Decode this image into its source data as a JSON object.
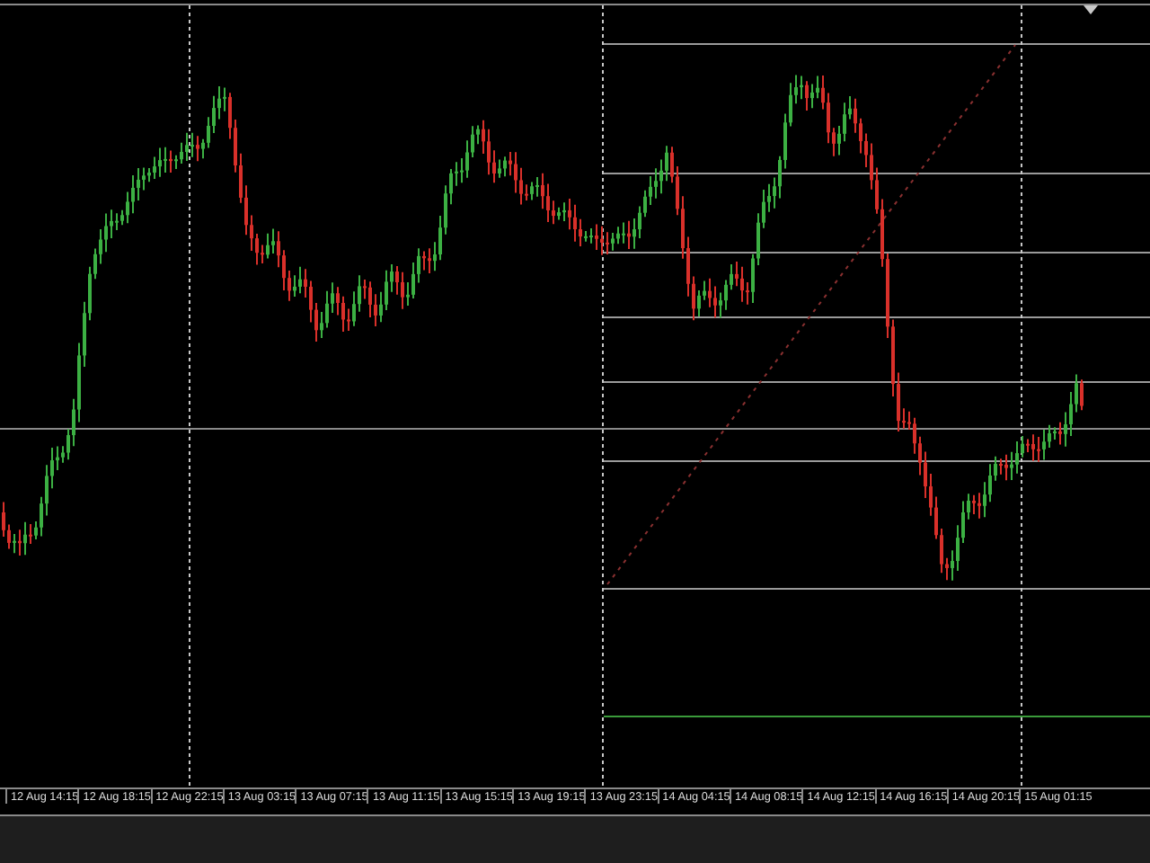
{
  "chart": {
    "x_axis_labels": [
      "12 Aug 14:15",
      "12 Aug 18:15",
      "12 Aug 22:15",
      "13 Aug 03:15",
      "13 Aug 07:15",
      "13 Aug 11:15",
      "13 Aug 15:15",
      "13 Aug 19:15",
      "13 Aug 23:15",
      "14 Aug 04:15",
      "14 Aug 08:15",
      "14 Aug 12:15",
      "14 Aug 16:15",
      "14 Aug 20:15",
      "15 Aug 01:15"
    ]
  }
}
